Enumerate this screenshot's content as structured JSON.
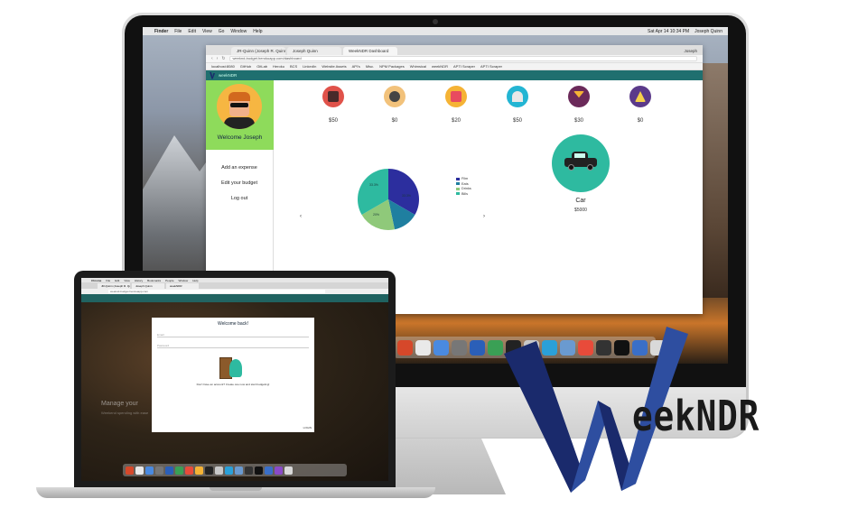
{
  "colors": {
    "teal_nav": "#1f6f6f",
    "profile_green": "#8edb5b",
    "car_circle": "#2ebaa0",
    "logo_navy": "#1a2a6c",
    "logo_blue": "#2e4ea0"
  },
  "imac": {
    "menubar": {
      "items": [
        "",
        "Finder",
        "File",
        "Edit",
        "View",
        "Go",
        "Window",
        "Help"
      ],
      "clock": "Sat Apr 14  10:34 PM",
      "user": "Joseph Quinn"
    },
    "browser": {
      "tabs": [
        "JR-Quinn (Joseph R. Quinn)",
        "Joseph Quinn",
        "WeekNDR Dashboard"
      ],
      "user": "Joseph",
      "url": "weeknd-budget.herokuapp.com/dashboard",
      "bookmarks": [
        "localhost:8080",
        "GitHub",
        "GitLab",
        "Heroku",
        "BCS",
        "LinkedIn",
        "Website Assets",
        "API's",
        "Misc.",
        "NPM Packages",
        "Whimsical",
        "weekNDR",
        "APTI Scraper",
        "APTI Scraper"
      ]
    },
    "app": {
      "brand": "weekNDR",
      "welcome": "Welcome Joseph",
      "menu": [
        "Add an expense",
        "Edit your budget",
        "Log out"
      ],
      "categories": [
        {
          "icon": "film-icon",
          "amount": "$50"
        },
        {
          "icon": "microphone-icon",
          "amount": "$0"
        },
        {
          "icon": "shopping-bag-icon",
          "amount": "$20"
        },
        {
          "icon": "food-tray-icon",
          "amount": "$50"
        },
        {
          "icon": "cocktail-icon",
          "amount": "$30"
        },
        {
          "icon": "mountain-icon",
          "amount": "$0"
        }
      ],
      "pie": {
        "slice_labels": [
          "33.3%",
          "20%",
          "33.3%"
        ],
        "legend": [
          "Film",
          "Eats",
          "Drinks",
          "Bills"
        ]
      },
      "carousel": {
        "prev": "‹",
        "next": "›"
      },
      "featured": {
        "icon": "car-icon",
        "name": "Car",
        "value": "$5000"
      }
    }
  },
  "macbook": {
    "menubar": [
      "",
      "Chrome",
      "File",
      "Edit",
      "View",
      "History",
      "Bookmarks",
      "People",
      "Window",
      "Help"
    ],
    "tabs": [
      "JR-Quinn (Joseph R. Quinn)",
      "Joseph Quinn",
      "weekNDR"
    ],
    "url": "weeknd-budget.herokuapp.com",
    "background_headline": "Manage your",
    "background_sub": "Weekend spending with ease",
    "login": {
      "title": "Welcome back!",
      "email_placeholder": "Email",
      "password_placeholder": "Password",
      "note": "Don't have an account? Create one now and start budgeting!",
      "button": "LOGIN"
    }
  },
  "logo": {
    "initial": "W",
    "rest": "eekNDR"
  },
  "chart_data": {
    "type": "pie",
    "categories": [
      "Film",
      "Eats",
      "Drinks",
      "Bills"
    ],
    "values": [
      33.3,
      13.4,
      20,
      33.3
    ],
    "colors": [
      "#2c2e9e",
      "#1f7fa0",
      "#8fc97a",
      "#2ebaa0"
    ],
    "title": "",
    "legend_position": "right"
  }
}
